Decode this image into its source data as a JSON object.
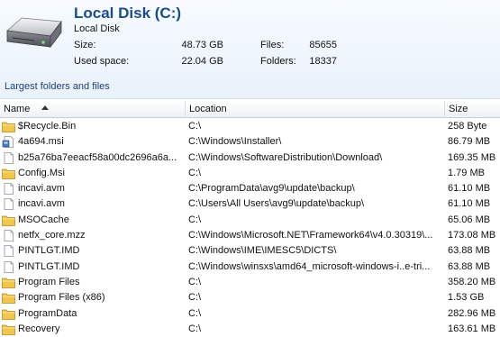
{
  "disk": {
    "title": "Local Disk (C:)",
    "subtitle": "Local Disk",
    "size_label": "Size:",
    "size_value": "48.73 GB",
    "used_label": "Used space:",
    "used_value": "22.04 GB",
    "files_label": "Files:",
    "files_value": "85655",
    "folders_label": "Folders:",
    "folders_value": "18337",
    "icon": "hard-drive-icon"
  },
  "section": {
    "title": "Largest folders and files"
  },
  "table": {
    "columns": {
      "name": "Name",
      "location": "Location",
      "size": "Size"
    },
    "sort": {
      "column": "name",
      "direction": "ascending"
    },
    "rows": [
      {
        "name": "$Recycle.Bin",
        "location": "C:\\",
        "size": "258 Byte",
        "icon": "folder-icon"
      },
      {
        "name": "4a694.msi",
        "location": "C:\\Windows\\Installer\\",
        "size": "86.79 MB",
        "icon": "installer-file-icon"
      },
      {
        "name": "b25a76ba7eeacf58a00dc2696a6a...",
        "location": "C:\\Windows\\SoftwareDistribution\\Download\\",
        "size": "169.35 MB",
        "icon": "file-icon"
      },
      {
        "name": "Config.Msi",
        "location": "C:\\",
        "size": "1.79 MB",
        "icon": "folder-icon"
      },
      {
        "name": "incavi.avm",
        "location": "C:\\ProgramData\\avg9\\update\\backup\\",
        "size": "61.10 MB",
        "icon": "file-icon"
      },
      {
        "name": "incavi.avm",
        "location": "C:\\Users\\All Users\\avg9\\update\\backup\\",
        "size": "61.10 MB",
        "icon": "file-icon"
      },
      {
        "name": "MSOCache",
        "location": "C:\\",
        "size": "65.06 MB",
        "icon": "folder-icon"
      },
      {
        "name": "netfx_core.mzz",
        "location": "C:\\Windows\\Microsoft.NET\\Framework64\\v4.0.30319\\...",
        "size": "173.08 MB",
        "icon": "file-icon"
      },
      {
        "name": "PINTLGT.IMD",
        "location": "C:\\Windows\\IME\\IMESC5\\DICTS\\",
        "size": "63.88 MB",
        "icon": "file-icon"
      },
      {
        "name": "PINTLGT.IMD",
        "location": "C:\\Windows\\winsxs\\amd64_microsoft-windows-i..e-tri...",
        "size": "63.88 MB",
        "icon": "file-icon"
      },
      {
        "name": "Program Files",
        "location": "C:\\",
        "size": "358.20 MB",
        "icon": "folder-icon"
      },
      {
        "name": "Program Files (x86)",
        "location": "C:\\",
        "size": "1.53 GB",
        "icon": "folder-icon"
      },
      {
        "name": "ProgramData",
        "location": "C:\\",
        "size": "282.96 MB",
        "icon": "folder-icon"
      },
      {
        "name": "Recovery",
        "location": "C:\\",
        "size": "163.61 MB",
        "icon": "folder-icon"
      }
    ]
  },
  "colors": {
    "title": "#1c4c8a",
    "folder": "#f2c64a",
    "header_bg": "#e9f1fb"
  }
}
